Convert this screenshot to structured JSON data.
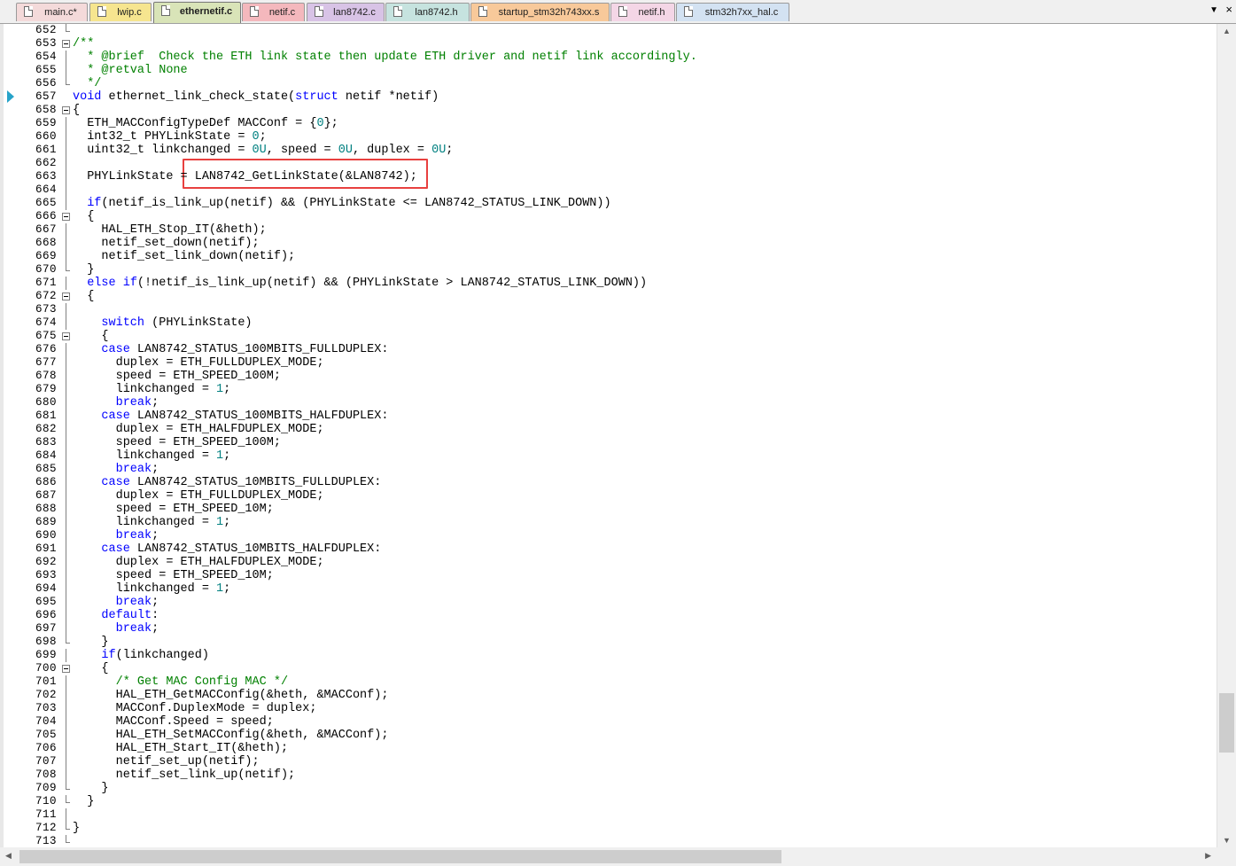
{
  "tabs": [
    {
      "label": "main.c*",
      "color": "#f4dada"
    },
    {
      "label": "lwip.c",
      "color": "#f6e58f"
    },
    {
      "label": "ethernetif.c",
      "color": "#d9e4b8",
      "active": true
    },
    {
      "label": "netif.c",
      "color": "#f4b8bd"
    },
    {
      "label": "lan8742.c",
      "color": "#d8c3e6"
    },
    {
      "label": "lan8742.h",
      "color": "#c6e3df"
    },
    {
      "label": "startup_stm32h743xx.s",
      "color": "#f8c99a"
    },
    {
      "label": "netif.h",
      "color": "#f4d6e6"
    },
    {
      "label": "stm32h7xx_hal.c",
      "color": "#d3e2f2"
    }
  ],
  "tab_controls": {
    "dropdown_icon": "▼",
    "close_icon": "×"
  },
  "colors": {
    "keyword": "#0000ff",
    "number": "#008080",
    "comment": "#008000",
    "highlight_box": "#e8403f",
    "current_line_marker": "#27a3c9"
  },
  "editor": {
    "current_line": 657,
    "highlighted_text": "LAN8742_GetLinkState(&LAN8742)",
    "lines": [
      {
        "n": "652",
        "fold": "end",
        "code": ""
      },
      {
        "n": "653",
        "fold": "box",
        "code": "/**",
        "cls": "cm"
      },
      {
        "n": "654",
        "fold": "vline",
        "code": "  * @brief  Check the ETH link state then update ETH driver and netif link accordingly.",
        "cls": "cm"
      },
      {
        "n": "655",
        "fold": "vline",
        "code": "  * @retval None",
        "cls": "cm"
      },
      {
        "n": "656",
        "fold": "end",
        "code": "  */",
        "cls": "cm"
      },
      {
        "n": "657",
        "fold": "",
        "code": "void ethernet_link_check_state(struct netif *netif)"
      },
      {
        "n": "658",
        "fold": "box",
        "code": "{"
      },
      {
        "n": "659",
        "fold": "vline",
        "code": "  ETH_MACConfigTypeDef MACConf = {0};"
      },
      {
        "n": "660",
        "fold": "vline",
        "code": "  int32_t PHYLinkState = 0;"
      },
      {
        "n": "661",
        "fold": "vline",
        "code": "  uint32_t linkchanged = 0U, speed = 0U, duplex = 0U;"
      },
      {
        "n": "662",
        "fold": "vline",
        "code": ""
      },
      {
        "n": "663",
        "fold": "vline",
        "code": "  PHYLinkState = LAN8742_GetLinkState(&LAN8742);"
      },
      {
        "n": "664",
        "fold": "vline",
        "code": ""
      },
      {
        "n": "665",
        "fold": "vline",
        "code": "  if(netif_is_link_up(netif) && (PHYLinkState <= LAN8742_STATUS_LINK_DOWN))"
      },
      {
        "n": "666",
        "fold": "box",
        "code": "  {"
      },
      {
        "n": "667",
        "fold": "vline",
        "code": "    HAL_ETH_Stop_IT(&heth);"
      },
      {
        "n": "668",
        "fold": "vline",
        "code": "    netif_set_down(netif);"
      },
      {
        "n": "669",
        "fold": "vline",
        "code": "    netif_set_link_down(netif);"
      },
      {
        "n": "670",
        "fold": "end",
        "code": "  }"
      },
      {
        "n": "671",
        "fold": "vline",
        "code": "  else if(!netif_is_link_up(netif) && (PHYLinkState > LAN8742_STATUS_LINK_DOWN))"
      },
      {
        "n": "672",
        "fold": "box",
        "code": "  {"
      },
      {
        "n": "673",
        "fold": "vline",
        "code": ""
      },
      {
        "n": "674",
        "fold": "vline",
        "code": "    switch (PHYLinkState)"
      },
      {
        "n": "675",
        "fold": "box",
        "code": "    {"
      },
      {
        "n": "676",
        "fold": "vline",
        "code": "    case LAN8742_STATUS_100MBITS_FULLDUPLEX:"
      },
      {
        "n": "677",
        "fold": "vline",
        "code": "      duplex = ETH_FULLDUPLEX_MODE;"
      },
      {
        "n": "678",
        "fold": "vline",
        "code": "      speed = ETH_SPEED_100M;"
      },
      {
        "n": "679",
        "fold": "vline",
        "code": "      linkchanged = 1;"
      },
      {
        "n": "680",
        "fold": "vline",
        "code": "      break;"
      },
      {
        "n": "681",
        "fold": "vline",
        "code": "    case LAN8742_STATUS_100MBITS_HALFDUPLEX:"
      },
      {
        "n": "682",
        "fold": "vline",
        "code": "      duplex = ETH_HALFDUPLEX_MODE;"
      },
      {
        "n": "683",
        "fold": "vline",
        "code": "      speed = ETH_SPEED_100M;"
      },
      {
        "n": "684",
        "fold": "vline",
        "code": "      linkchanged = 1;"
      },
      {
        "n": "685",
        "fold": "vline",
        "code": "      break;"
      },
      {
        "n": "686",
        "fold": "vline",
        "code": "    case LAN8742_STATUS_10MBITS_FULLDUPLEX:"
      },
      {
        "n": "687",
        "fold": "vline",
        "code": "      duplex = ETH_FULLDUPLEX_MODE;"
      },
      {
        "n": "688",
        "fold": "vline",
        "code": "      speed = ETH_SPEED_10M;"
      },
      {
        "n": "689",
        "fold": "vline",
        "code": "      linkchanged = 1;"
      },
      {
        "n": "690",
        "fold": "vline",
        "code": "      break;"
      },
      {
        "n": "691",
        "fold": "vline",
        "code": "    case LAN8742_STATUS_10MBITS_HALFDUPLEX:"
      },
      {
        "n": "692",
        "fold": "vline",
        "code": "      duplex = ETH_HALFDUPLEX_MODE;"
      },
      {
        "n": "693",
        "fold": "vline",
        "code": "      speed = ETH_SPEED_10M;"
      },
      {
        "n": "694",
        "fold": "vline",
        "code": "      linkchanged = 1;"
      },
      {
        "n": "695",
        "fold": "vline",
        "code": "      break;"
      },
      {
        "n": "696",
        "fold": "vline",
        "code": "    default:"
      },
      {
        "n": "697",
        "fold": "vline",
        "code": "      break;"
      },
      {
        "n": "698",
        "fold": "end",
        "code": "    }"
      },
      {
        "n": "699",
        "fold": "vline",
        "code": "    if(linkchanged)"
      },
      {
        "n": "700",
        "fold": "box",
        "code": "    {"
      },
      {
        "n": "701",
        "fold": "vline",
        "code": "      /* Get MAC Config MAC */"
      },
      {
        "n": "702",
        "fold": "vline",
        "code": "      HAL_ETH_GetMACConfig(&heth, &MACConf);"
      },
      {
        "n": "703",
        "fold": "vline",
        "code": "      MACConf.DuplexMode = duplex;"
      },
      {
        "n": "704",
        "fold": "vline",
        "code": "      MACConf.Speed = speed;"
      },
      {
        "n": "705",
        "fold": "vline",
        "code": "      HAL_ETH_SetMACConfig(&heth, &MACConf);"
      },
      {
        "n": "706",
        "fold": "vline",
        "code": "      HAL_ETH_Start_IT(&heth);"
      },
      {
        "n": "707",
        "fold": "vline",
        "code": "      netif_set_up(netif);"
      },
      {
        "n": "708",
        "fold": "vline",
        "code": "      netif_set_link_up(netif);"
      },
      {
        "n": "709",
        "fold": "end",
        "code": "    }"
      },
      {
        "n": "710",
        "fold": "end",
        "code": "  }"
      },
      {
        "n": "711",
        "fold": "vline",
        "code": ""
      },
      {
        "n": "712",
        "fold": "end",
        "code": "}"
      },
      {
        "n": "713",
        "fold": "end",
        "code": ""
      }
    ]
  },
  "scrollbars": {
    "up_arrow": "▲",
    "down_arrow": "▼",
    "left_arrow": "◀",
    "right_arrow": "▶"
  }
}
